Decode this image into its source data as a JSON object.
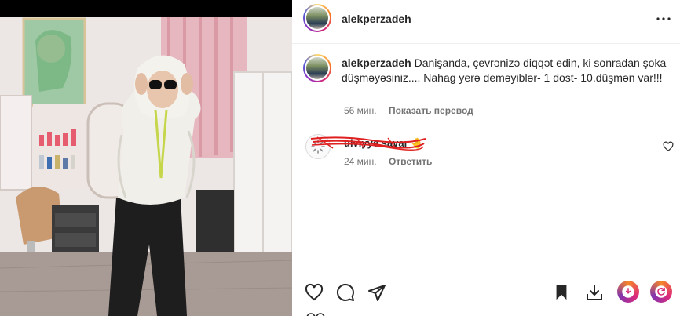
{
  "post": {
    "username": "alekperzadeh",
    "caption": {
      "username": "alekperzadeh",
      "text": "Danişanda, çevrənizə diqqət edin, ki sonradan şoka düşməyəsiniz.... Nahag yerə deməyiblər- 1 dost- 10.düşmən var!!!",
      "time": "56 мин.",
      "translate_label": "Показать перевод"
    },
    "comment": {
      "username": "ulviyye.savar",
      "emoji": "🤚",
      "time": "24 мин.",
      "reply_label": "Ответить"
    }
  },
  "icons": {
    "more": "more-horizontal-icon",
    "like": "heart-icon",
    "comment": "comment-icon",
    "share": "send-icon",
    "save": "bookmark-icon",
    "download": "download-icon",
    "ext1": "extension-icon",
    "ext2": "extension-icon"
  },
  "colors": {
    "text": "#262626",
    "muted": "#737373",
    "scribble": "#e02020",
    "border": "#efefef"
  }
}
